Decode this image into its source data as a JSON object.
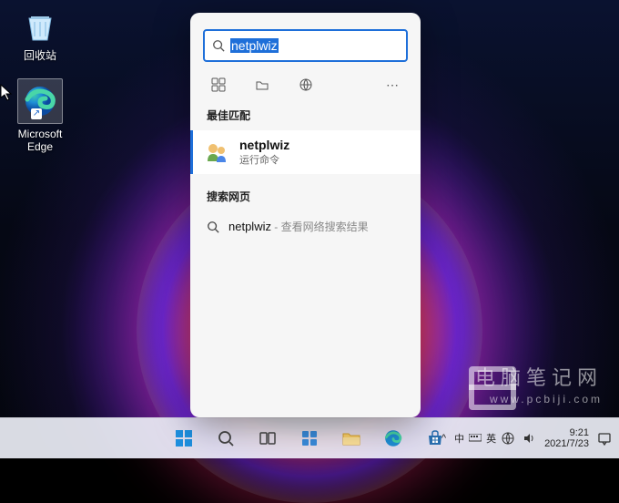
{
  "desktop": {
    "recycle_bin_label": "回收站",
    "edge_label": "Microsoft Edge"
  },
  "search": {
    "query": "netplwiz",
    "best_match_header": "最佳匹配",
    "best_match": {
      "title": "netplwiz",
      "subtitle": "运行命令"
    },
    "web_header": "搜索网页",
    "web_result": {
      "query": "netplwiz",
      "hint": " - 查看网络搜索结果"
    }
  },
  "taskbar": {
    "tray": {
      "chevron": "^",
      "lang1": "中",
      "lang2": "英",
      "ime": "⌨"
    },
    "clock": {
      "time": "9:21",
      "date": "2021/7/23"
    }
  },
  "watermark": {
    "text": "电脑笔记网",
    "domain": "www.pcbiji.com"
  }
}
